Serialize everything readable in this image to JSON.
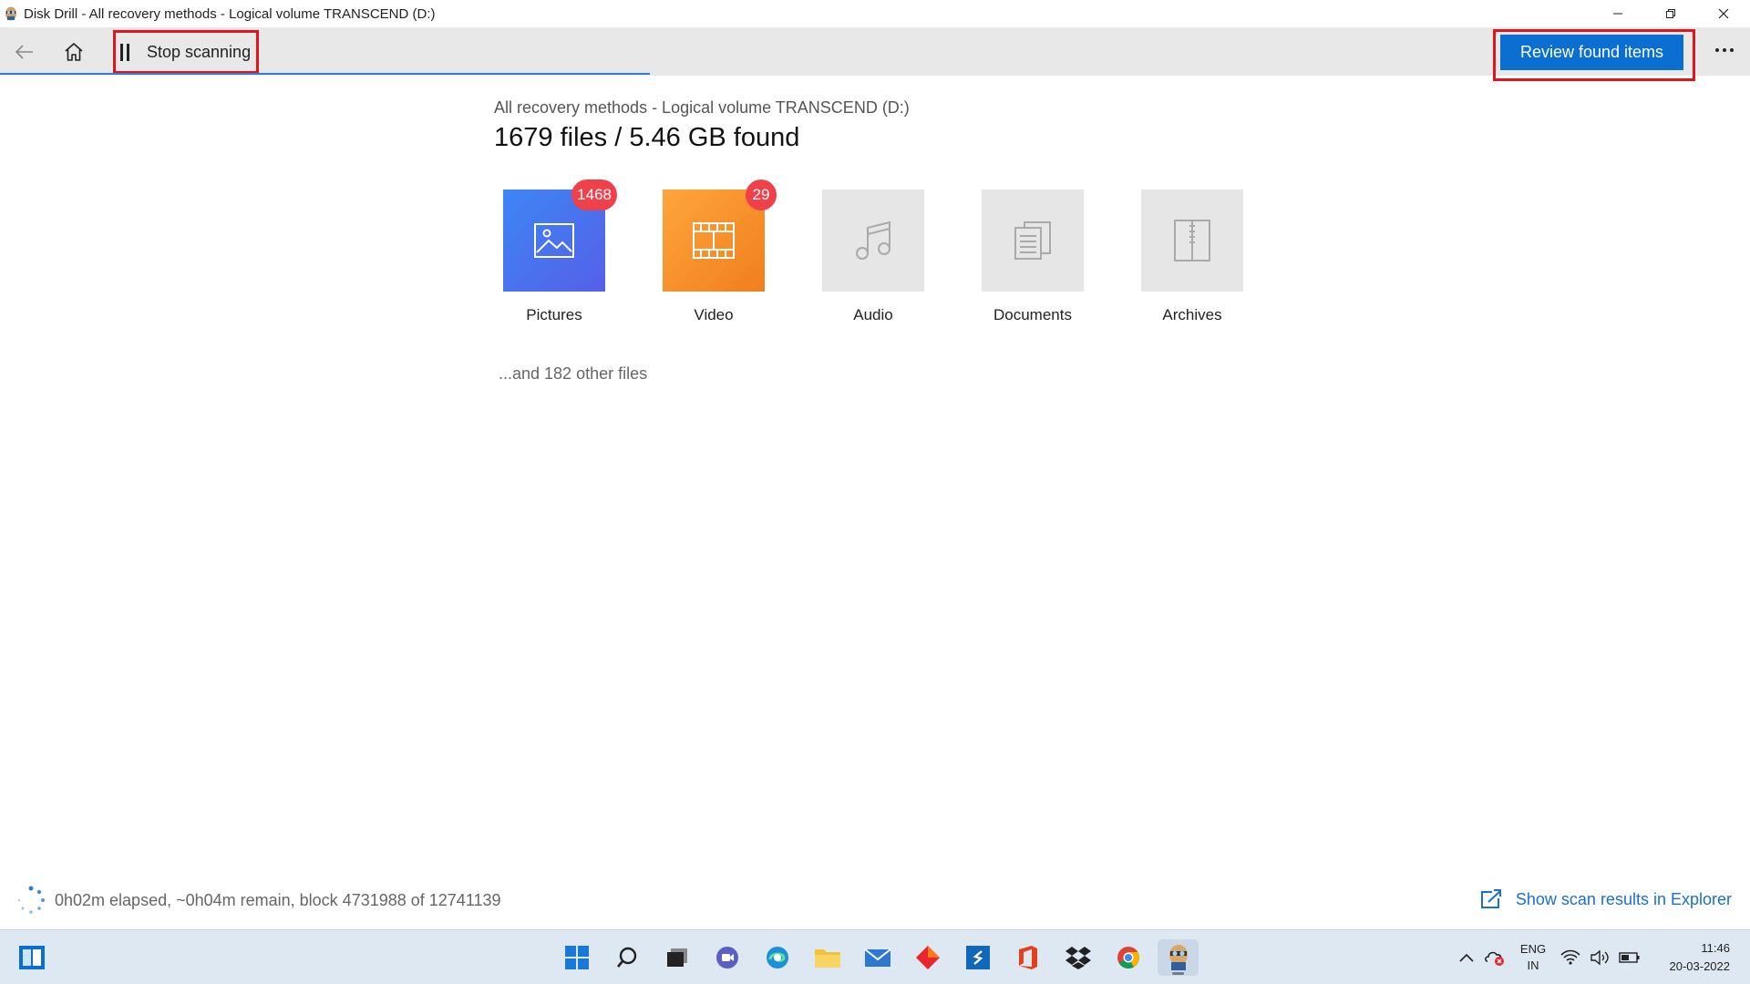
{
  "window": {
    "title": "Disk Drill - All recovery methods - Logical volume TRANSCEND (D:)"
  },
  "toolbar": {
    "stop_label": "Stop scanning",
    "review_label": "Review found items"
  },
  "main": {
    "subtitle": "All recovery methods - Logical volume TRANSCEND (D:)",
    "headline": "1679 files / 5.46 GB found",
    "categories": [
      {
        "label": "Pictures",
        "count": "1468",
        "icon": "image-icon"
      },
      {
        "label": "Video",
        "count": "29",
        "icon": "film-icon"
      },
      {
        "label": "Audio",
        "count": "",
        "icon": "music-note-icon"
      },
      {
        "label": "Documents",
        "count": "",
        "icon": "document-icon"
      },
      {
        "label": "Archives",
        "count": "",
        "icon": "archive-icon"
      }
    ],
    "other_files": "...and 182 other files"
  },
  "status": {
    "progress_text": "0h02m elapsed, ~0h04m remain, block 4731988 of 12741139",
    "explorer_link": "Show scan results in Explorer"
  },
  "taskbar": {
    "lang_top": "ENG",
    "lang_bottom": "IN",
    "time": "11:46",
    "date": "20-03-2022"
  },
  "colors": {
    "accent": "#0a6fd0",
    "highlight_frame": "#e0151b",
    "badge": "#f0404a",
    "pictures_tile": "#4a74ee",
    "video_tile": "#f7912b"
  }
}
